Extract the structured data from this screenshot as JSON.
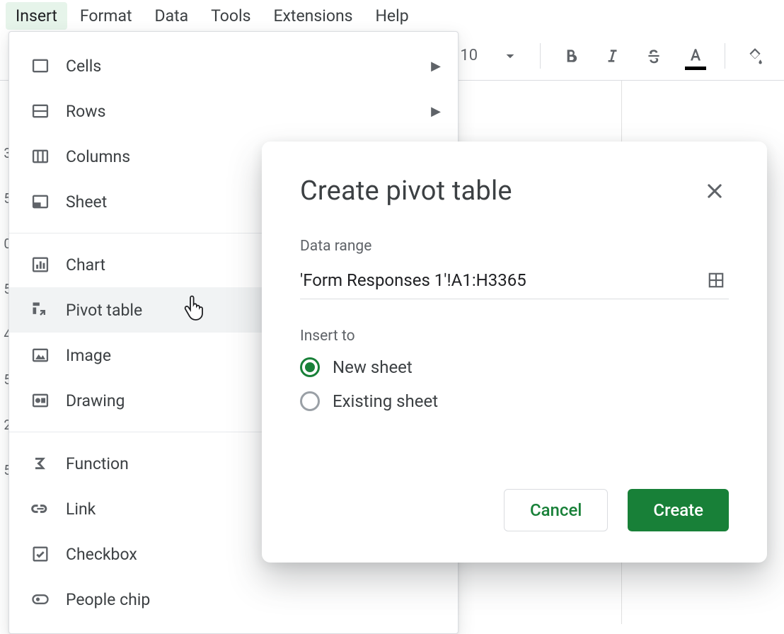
{
  "menubar": {
    "insert": "Insert",
    "format": "Format",
    "data": "Data",
    "tools": "Tools",
    "extensions": "Extensions",
    "help": "Help"
  },
  "toolbar": {
    "font_size": "10"
  },
  "insert_menu": {
    "cells": "Cells",
    "rows": "Rows",
    "columns": "Columns",
    "sheet": "Sheet",
    "chart": "Chart",
    "pivot_table": "Pivot table",
    "image": "Image",
    "drawing": "Drawing",
    "function": "Function",
    "link": "Link",
    "checkbox": "Checkbox",
    "people_chip": "People chip"
  },
  "dialog": {
    "title": "Create pivot table",
    "data_range_label": "Data range",
    "data_range_value": "'Form Responses 1'!A1:H3365",
    "insert_to_label": "Insert to",
    "option_new_sheet": "New sheet",
    "option_existing_sheet": "Existing sheet",
    "cancel": "Cancel",
    "create": "Create"
  },
  "row_numbers_partial": [
    "3",
    "5",
    "0",
    "5",
    "4",
    "5",
    "2",
    "5"
  ]
}
